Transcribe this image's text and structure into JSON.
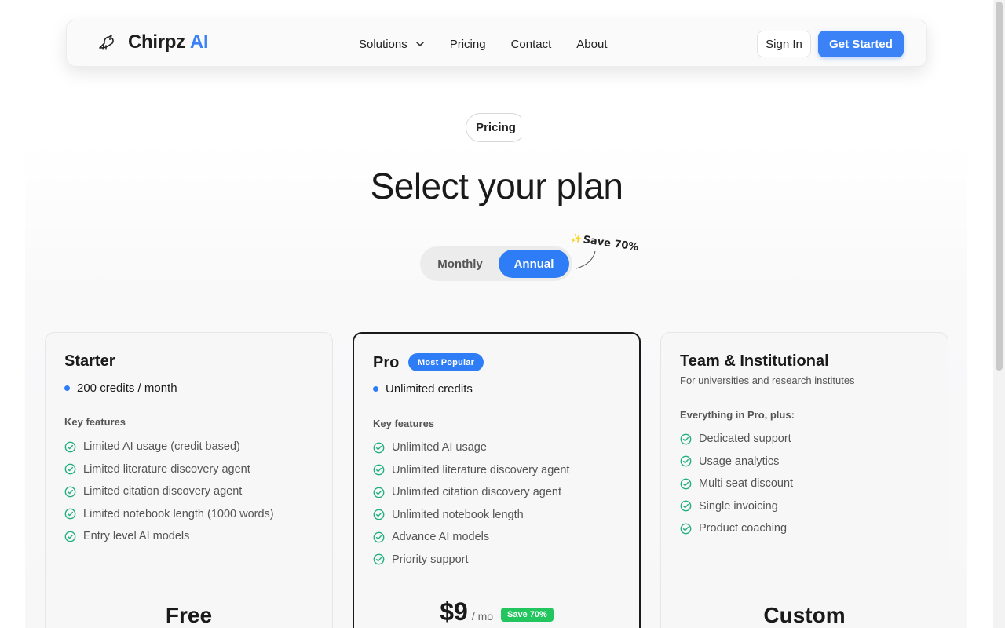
{
  "nav": {
    "brand": "Chirpz",
    "brand_accent": "AI",
    "links": [
      "Solutions",
      "Pricing",
      "Contact",
      "About"
    ],
    "sign_in": "Sign In",
    "get_started": "Get Started"
  },
  "hero": {
    "pill": "Pricing",
    "title": "Select your plan",
    "toggle_monthly": "Monthly",
    "toggle_annual": "Annual",
    "save_note": "Save 70%"
  },
  "plans": [
    {
      "name": "Starter",
      "credits": "200 credits / month",
      "features_heading": "Key features",
      "features": [
        "Limited AI usage (credit based)",
        "Limited literature discovery agent",
        "Limited citation discovery agent",
        "Limited notebook length (1000 words)",
        "Entry level AI models"
      ],
      "price": "Free"
    },
    {
      "name": "Pro",
      "badge": "Most Popular",
      "credits": "Unlimited credits",
      "features_heading": "Key features",
      "features": [
        "Unlimited AI usage",
        "Unlimited literature discovery agent",
        "Unlimited citation discovery agent",
        "Unlimited notebook length",
        "Advance AI models",
        "Priority support"
      ],
      "price": "$9",
      "price_unit": "/ mo",
      "save_badge": "Save 70%"
    },
    {
      "name": "Team & Institutional",
      "subtitle": "For universities and research institutes",
      "features_heading": "Everything in Pro, plus:",
      "features": [
        "Dedicated support",
        "Usage analytics",
        "Multi seat discount",
        "Single invoicing",
        "Product coaching"
      ],
      "price": "Custom"
    }
  ],
  "colors": {
    "accent": "#2f7df6",
    "check": "#22b07d",
    "save_badge": "#22c55e"
  }
}
